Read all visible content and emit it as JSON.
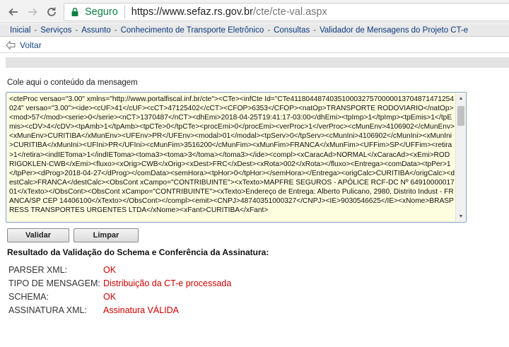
{
  "browser": {
    "secure_label": "Seguro",
    "url_host": "https://www.sefaz.rs.gov.br",
    "url_path": "/cte/cte-val.aspx"
  },
  "breadcrumb": [
    "Inicial",
    "Serviços",
    "Assunto",
    "Conhecimento de Transporte Eletrônico",
    "Consultas",
    "Validador de Mensagens do Projeto CT-e"
  ],
  "back_link": "Voltar",
  "input_label": "Cole aqui o conteúdo da mensagem",
  "xml_content": "<cteProc versao=\"3.00\" xmlns=\"http://www.portalfiscal.inf.br/cte\"><CTe><infCte Id=\"CTe41180448740351000327570000013704871471254024\" versao=\"3.00\"><ide><cUF>41</cUF><cCT>47125402</cCT><CFOP>6353</CFOP><natOp>TRANSPORTE RODOVIARIO</natOp><mod>57</mod><serie>0</serie><nCT>1370487</nCT><dhEmi>2018-04-25T19:41:17-03:00</dhEmi><tpImp>1</tpImp><tpEmis>1</tpEmis><cDV>4</cDV><tpAmb>1</tpAmb><tpCTe>0</tpCTe><procEmi>0</procEmi><verProc>1</verProc><cMunEnv>4106902</cMunEnv><xMunEnv>CURITIBA</xMunEnv><UFEnv>PR</UFEnv><modal>01</modal><tpServ>0</tpServ><cMunIni>4106902</cMunIni><xMunIni>CURITIBA</xMunIni><UFIni>PR</UFIni><cMunFim>3516200</cMunFim><xMunFim>FRANCA</xMunFim><UFFim>SP</UFFim><retira>1</retira><indIEToma>1</indIEToma><toma3><toma>3</toma></toma3></ide><compl><xCaracAd>NORMAL</xCaracAd><xEmi>RODRIGOKLEN-CWB</xEmi><fluxo><xOrig>CWB</xOrig><xDest>FRC</xDest><xRota>002</xRota></fluxo><Entrega><comData><tpPer>1</tpPer><dProg>2018-04-27</dProg></comData><semHora><tpHor>0</tpHor></semHora></Entrega><origCalc>CURITIBA</origCalc><destCalc>FRANCA</destCalc><ObsCont xCampo=\"CONTRIBUINTE\"><xTexto>MAPFRE SEGUROS - APÓLICE RCF-DC Nº 6491000001701</xTexto></ObsCont><ObsCont xCampo=\"CONTRIBUINTE\"><xTexto>Endereço de Entrega: Alberto Pulicano, 2980, Distrito Indust - FRANCA/SP CEP 14406100</xTexto></ObsCont></compl><emit><CNPJ>48740351000327</CNPJ><IE>9030546625</IE><xNome>BRASPRESS TRANSPORTES URGENTES LTDA</xNome><xFant>CURITIBA</xFant>",
  "buttons": {
    "validate": "Validar",
    "clear": "Limpar"
  },
  "result_title": "Resultado da Validação do Schema e Conferência da Assinatura:",
  "results": [
    {
      "key": "PARSER XML:",
      "value": "OK"
    },
    {
      "key": "TIPO DE MENSAGEM:",
      "value": "Distribuição da CT-e processada"
    },
    {
      "key": "SCHEMA:",
      "value": "OK"
    },
    {
      "key": "ASSINATURA XML:",
      "value": "Assinatura VÁLIDA"
    }
  ],
  "colors": {
    "secure": "#0b8043",
    "result_value": "#cc0000",
    "link": "#0a3a80"
  }
}
